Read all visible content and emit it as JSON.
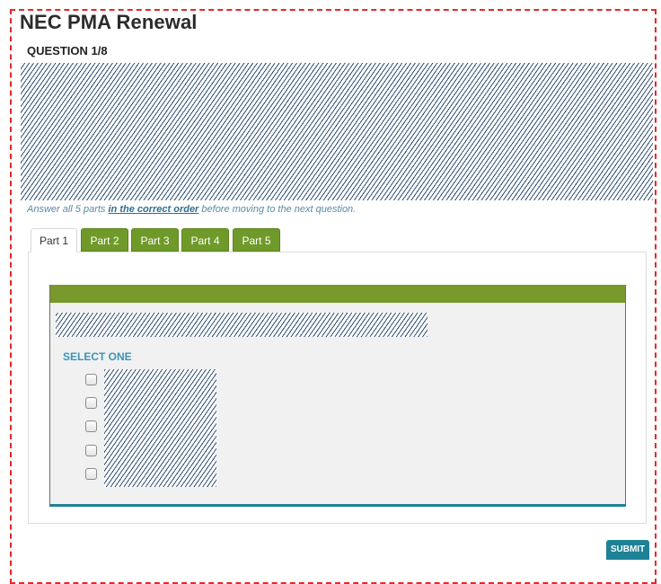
{
  "page": {
    "title": "NEC PMA Renewal"
  },
  "question": {
    "label": "QUESTION 1/8",
    "instruction_prefix": "Answer all 5 parts ",
    "instruction_emphasis": "in the correct order",
    "instruction_suffix": " before moving to the next question."
  },
  "tabs": [
    {
      "label": "Part 1",
      "active": true
    },
    {
      "label": "Part 2",
      "active": false
    },
    {
      "label": "Part 3",
      "active": false
    },
    {
      "label": "Part 4",
      "active": false
    },
    {
      "label": "Part 5",
      "active": false
    }
  ],
  "card": {
    "select_label": "SELECT ONE",
    "options": [
      {
        "checked": false
      },
      {
        "checked": false
      },
      {
        "checked": false
      },
      {
        "checked": false
      },
      {
        "checked": false
      }
    ]
  },
  "actions": {
    "submit_label": "SUBMIT"
  },
  "colors": {
    "frame_border": "#e8262a",
    "tab_green": "#6f9a2a",
    "card_header": "#78992b",
    "accent_teal": "#1e8296",
    "select_label": "#3d93b5",
    "instruction": "#5b8aa6"
  }
}
